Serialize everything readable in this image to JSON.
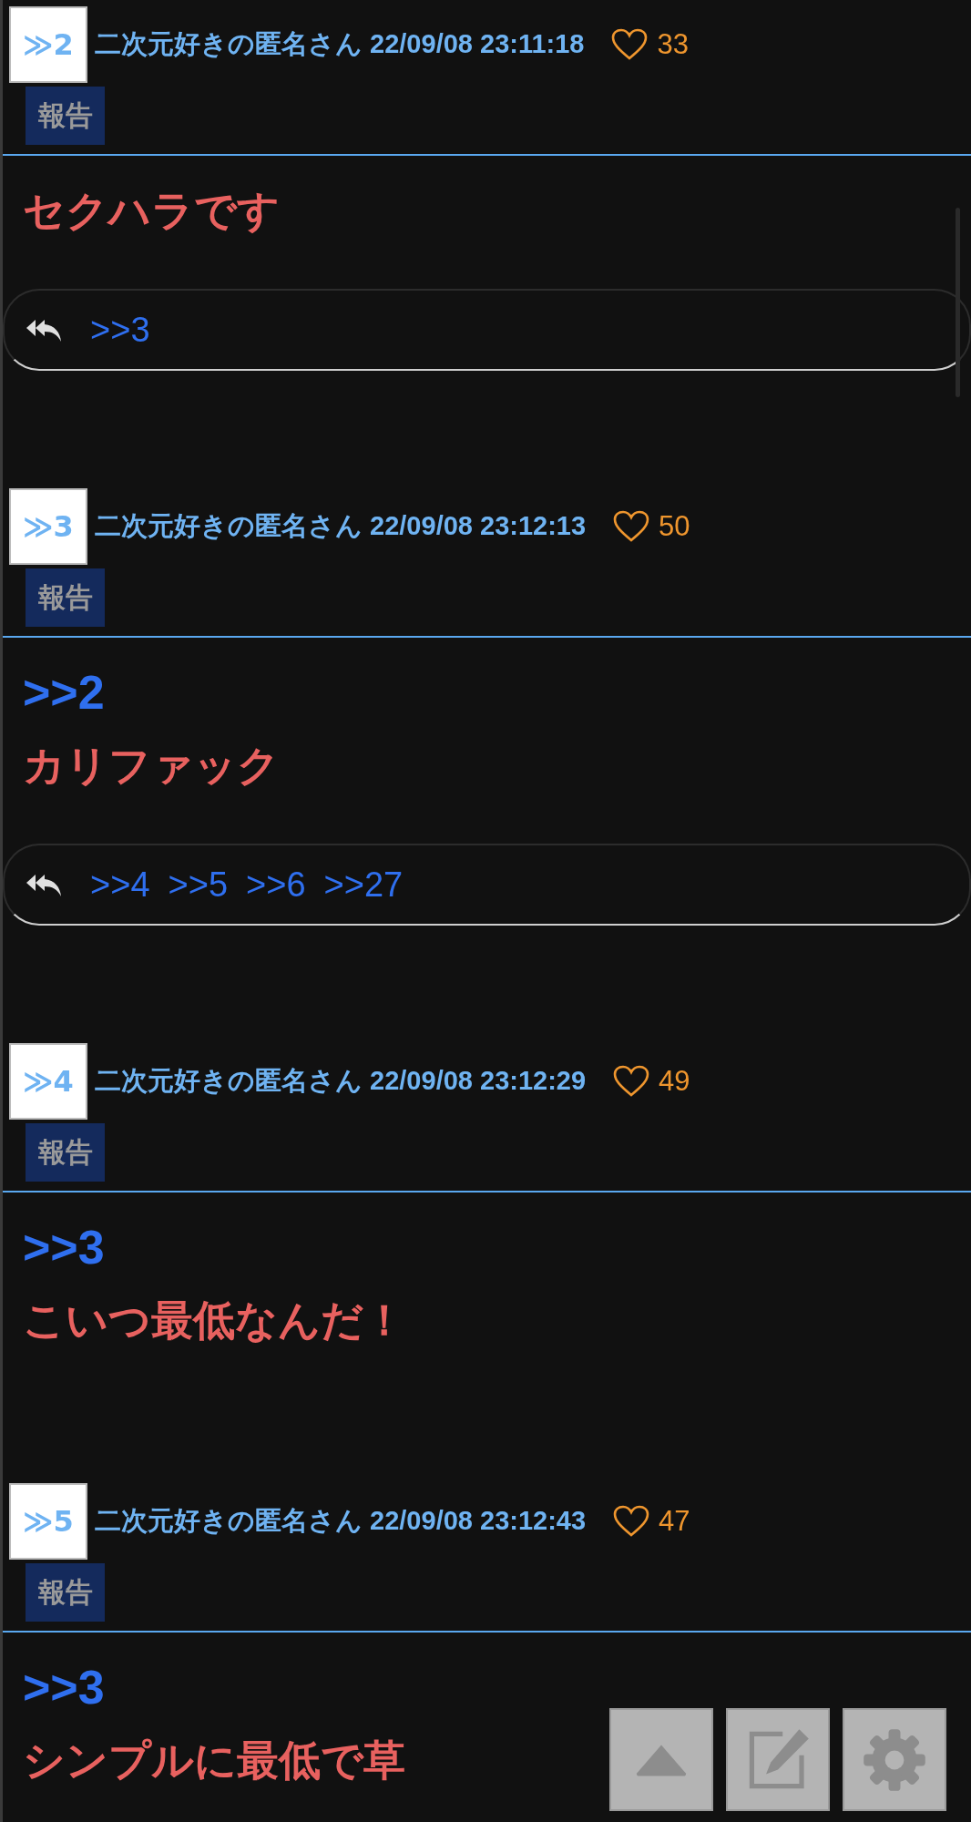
{
  "posts": [
    {
      "number": "≫2",
      "name": "二次元好きの匿名さん",
      "date": "22/09/08 23:11:18",
      "likes": "33",
      "report": "報告",
      "body": [
        {
          "kind": "text",
          "text": "セクハラです"
        }
      ],
      "replies": [
        ">>3"
      ]
    },
    {
      "number": "≫3",
      "name": "二次元好きの匿名さん",
      "date": "22/09/08 23:12:13",
      "likes": "50",
      "report": "報告",
      "body": [
        {
          "kind": "quote",
          "text": ">>2"
        },
        {
          "kind": "text",
          "text": "カリファック"
        }
      ],
      "replies": [
        ">>4",
        ">>5",
        ">>6",
        ">>27"
      ]
    },
    {
      "number": "≫4",
      "name": "二次元好きの匿名さん",
      "date": "22/09/08 23:12:29",
      "likes": "49",
      "report": "報告",
      "body": [
        {
          "kind": "quote",
          "text": ">>3"
        },
        {
          "kind": "text",
          "text": "こいつ最低なんだ！"
        }
      ]
    },
    {
      "number": "≫5",
      "name": "二次元好きの匿名さん",
      "date": "22/09/08 23:12:43",
      "likes": "47",
      "report": "報告",
      "body": [
        {
          "kind": "quote",
          "text": ">>3"
        },
        {
          "kind": "text",
          "text": "シンプルに最低で草"
        }
      ]
    }
  ]
}
